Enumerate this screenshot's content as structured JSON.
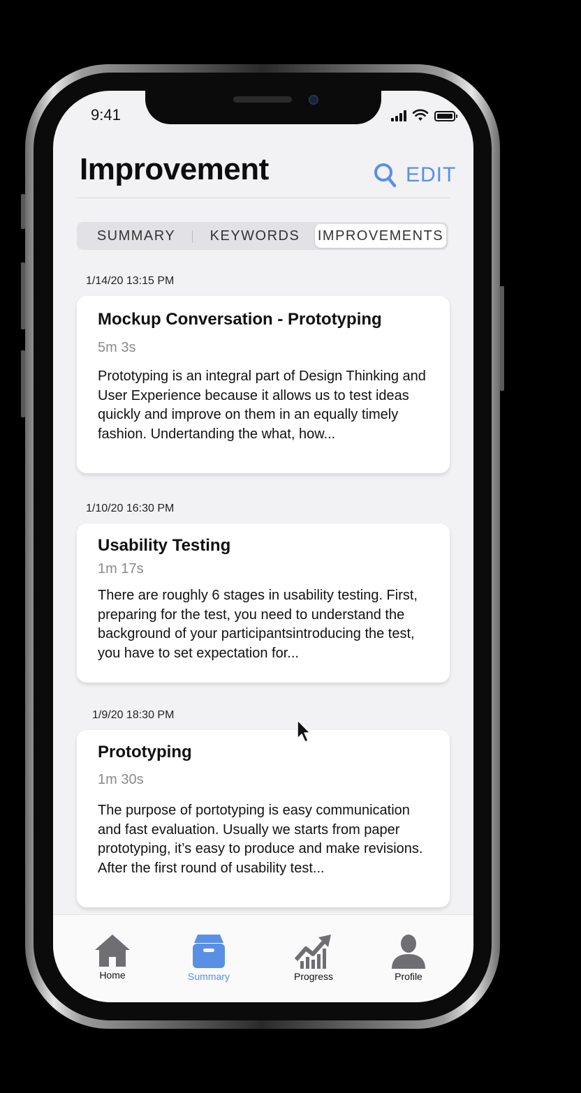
{
  "status": {
    "time": "9:41"
  },
  "header": {
    "title": "Improvement",
    "edit_label": "EDIT"
  },
  "tabs": [
    {
      "label": "SUMMARY",
      "active": false
    },
    {
      "label": "KEYWORDS",
      "active": false
    },
    {
      "label": "IMPROVEMENTS",
      "active": true
    }
  ],
  "entries": [
    {
      "date": "1/14/20 13:15 PM",
      "title": "Mockup Conversation - Prototyping",
      "duration": "5m 3s",
      "body": "Prototyping is an integral part of Design Thinking and User Experience because it allows us to test ideas quickly and improve on them in an equally timely fashion. Undertanding the what, how..."
    },
    {
      "date": "1/10/20  16:30 PM",
      "title": "Usability Testing",
      "duration": "1m 17s",
      "body": "There are roughly 6 stages in usability testing. First, preparing for the test, you need to understand the background of your participantsintroducing the test, you have to set expectation for..."
    },
    {
      "date": "1/9/20  18:30 PM",
      "title": "Prototyping",
      "duration": "1m 30s",
      "body": "The purpose of portotyping is easy communication and fast evaluation. Usually we starts from paper prototyping, it’s easy to produce and make revisions. After the first round of usability test..."
    }
  ],
  "tabbar": {
    "items": [
      {
        "label": "Home",
        "icon": "home-icon",
        "active": false
      },
      {
        "label": "Summary",
        "icon": "archive-box-icon",
        "active": true
      },
      {
        "label": "Progress",
        "icon": "chart-up-icon",
        "active": false
      },
      {
        "label": "Profile",
        "icon": "person-icon",
        "active": false
      }
    ]
  },
  "colors": {
    "accent": "#5a8fe6",
    "icon_gray": "#6e6e73",
    "background": "#f2f2f4"
  }
}
